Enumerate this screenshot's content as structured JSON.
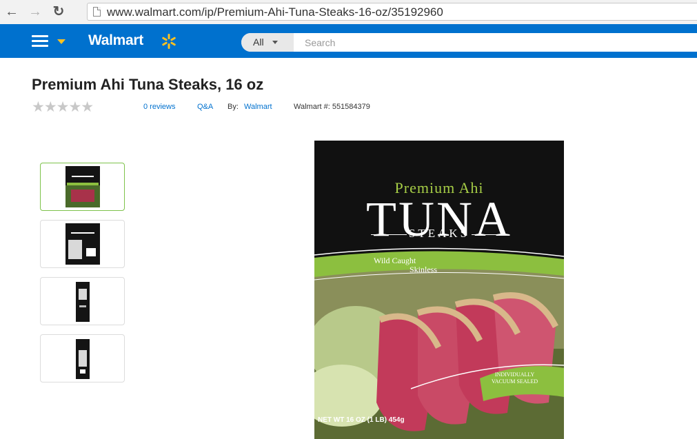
{
  "browser": {
    "url": "www.walmart.com/ip/Premium-Ahi-Tuna-Steaks-16-oz/35192960"
  },
  "header": {
    "brand": "Walmart",
    "search": {
      "department": "All",
      "placeholder": "Search"
    },
    "colors": {
      "bar": "#0071ce",
      "spark": "#ffc220"
    }
  },
  "product": {
    "title": "Premium Ahi Tuna Steaks, 16 oz",
    "rating": {
      "stars": 0,
      "max": 5,
      "reviews_text": "0 reviews"
    },
    "qa_text": "Q&A",
    "by_label": "By:",
    "brand_link": "Walmart",
    "item_number": "Walmart #: 551584379"
  },
  "gallery": {
    "thumbnails": [
      {
        "selected": true
      },
      {
        "selected": false
      },
      {
        "selected": false
      },
      {
        "selected": false
      }
    ],
    "main_image": {
      "line1": "Premium Ahi",
      "line2": "TUNA",
      "line3": "STEAKS",
      "band_line1": "Wild Caught",
      "band_line2": "Skinless",
      "seal_line1": "INDIVIDUALLY",
      "seal_line2": "VACUUM SEALED",
      "net_weight": "NET WT 16 OZ (1 LB) 454g"
    }
  }
}
